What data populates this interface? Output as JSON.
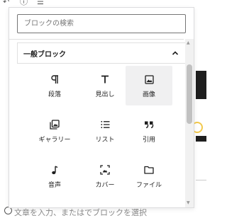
{
  "colors": {
    "text": "#1e1e1e",
    "border": "#757575",
    "selected_bg": "#f0f0f1",
    "accent_yellow": "#f2c94c"
  },
  "toolbar": {
    "icons": [
      "undo-icon",
      "info-icon",
      "list-view-icon"
    ]
  },
  "inserter": {
    "search": {
      "placeholder": "ブロックの検索",
      "value": ""
    },
    "panel": {
      "title": "一般ブロック",
      "expanded": true
    },
    "blocks": [
      {
        "label": "段落",
        "icon": "paragraph-icon",
        "selected": false
      },
      {
        "label": "見出し",
        "icon": "heading-icon",
        "selected": false
      },
      {
        "label": "画像",
        "icon": "image-icon",
        "selected": true
      },
      {
        "label": "ギャラリー",
        "icon": "gallery-icon",
        "selected": false
      },
      {
        "label": "リスト",
        "icon": "list-icon",
        "selected": false
      },
      {
        "label": "引用",
        "icon": "quote-icon",
        "selected": false
      },
      {
        "label": "音声",
        "icon": "audio-icon",
        "selected": false
      },
      {
        "label": "カバー",
        "icon": "cover-icon",
        "selected": false
      },
      {
        "label": "ファイル",
        "icon": "file-icon",
        "selected": false
      }
    ]
  },
  "background": {
    "bottom_text": "文章を入力、またはでブロックを選択"
  }
}
